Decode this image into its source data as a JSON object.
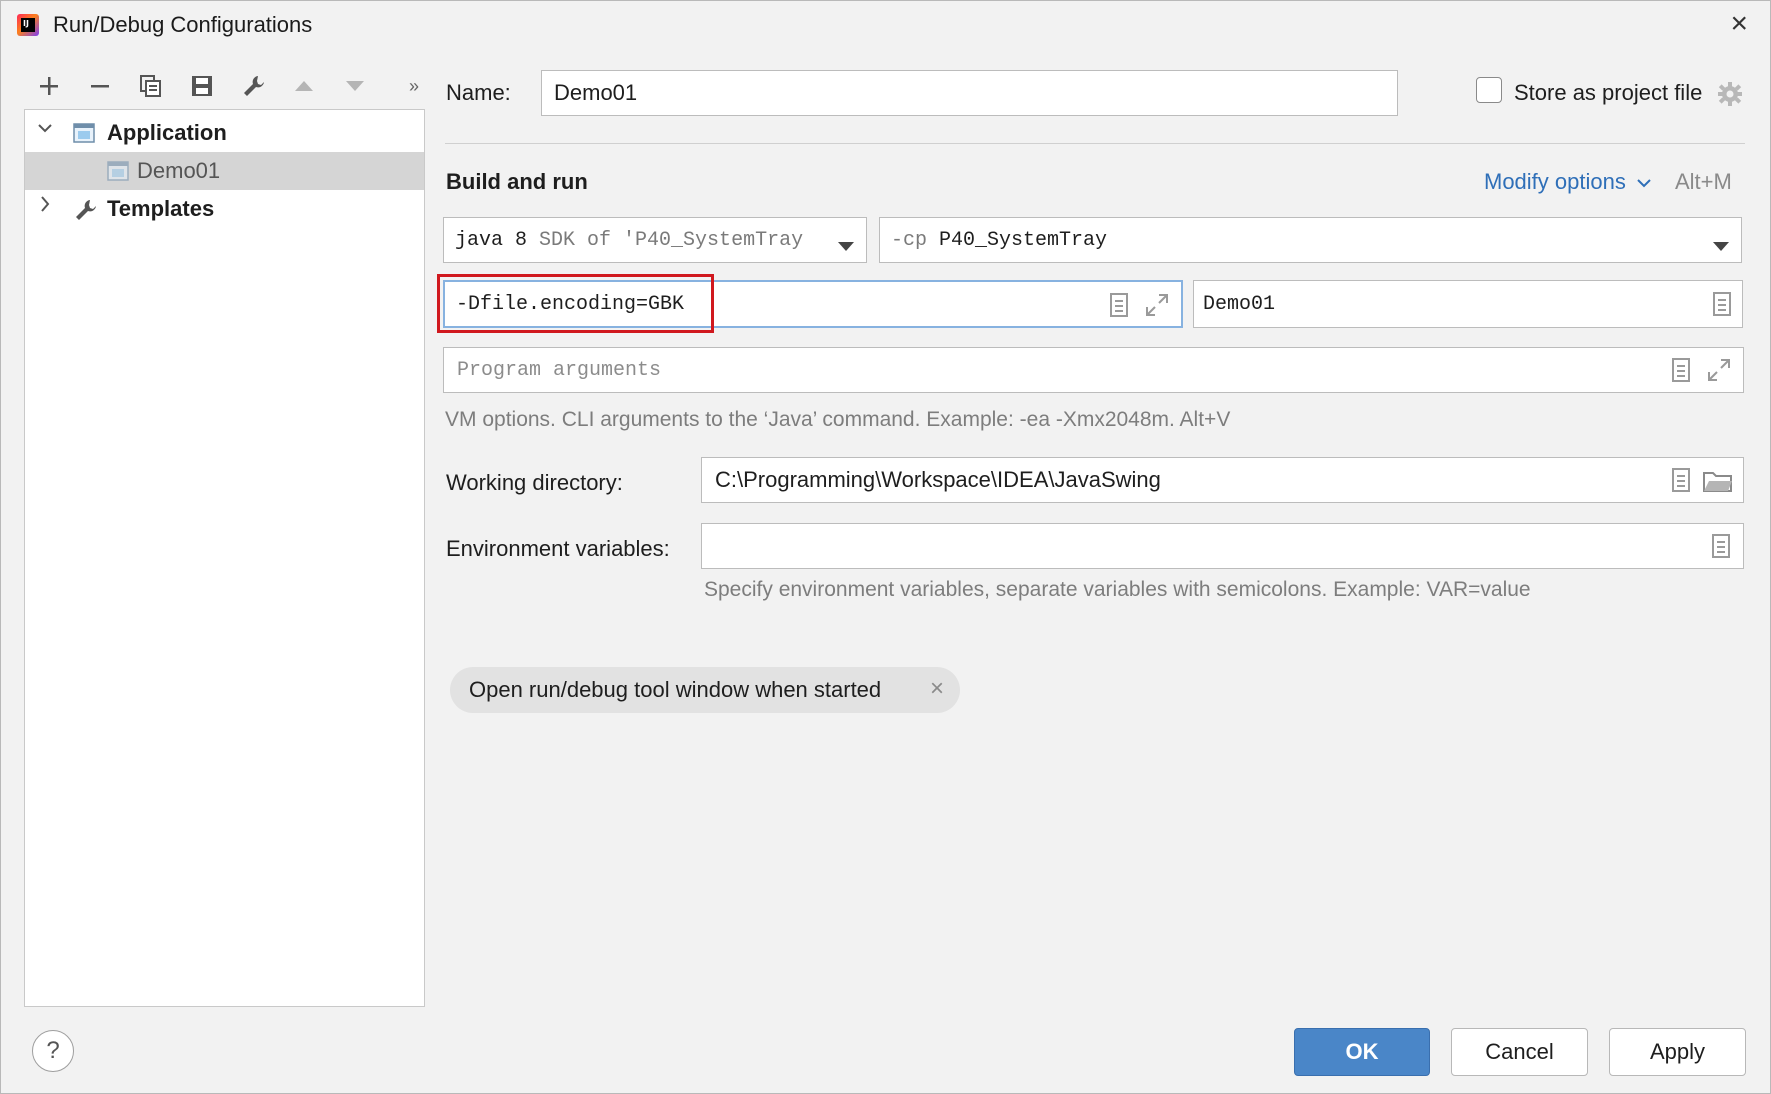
{
  "window": {
    "title": "Run/Debug Configurations"
  },
  "tree": {
    "items": [
      {
        "label": "Application",
        "expanded": true
      },
      {
        "label": "Demo01",
        "selected": true
      },
      {
        "label": "Templates",
        "expanded": false
      }
    ]
  },
  "form": {
    "name_label": "Name:",
    "name_value": "Demo01",
    "store_label": "Store as project file",
    "section_title": "Build and run",
    "modify_options": "Modify options",
    "modify_shortcut": "Alt+M",
    "jdk_main": "java 8",
    "jdk_rest": "SDK of 'P40_SystemTray",
    "cp_prefix": "-cp",
    "cp_value": "P40_SystemTray",
    "vm_options": "-Dfile.encoding=GBK",
    "main_class": "Demo01",
    "program_args_placeholder": "Program arguments",
    "vm_hint": "VM options. CLI arguments to the ‘Java’ command. Example: -ea -Xmx2048m. Alt+V",
    "workdir_label": "Working directory:",
    "workdir_value": "C:\\Programming\\Workspace\\IDEA\\JavaSwing",
    "env_label": "Environment variables:",
    "env_value": "",
    "env_hint": "Specify environment variables, separate variables with semicolons. Example: VAR=value",
    "chip_label": "Open run/debug tool window when started"
  },
  "buttons": {
    "help": "?",
    "ok": "OK",
    "cancel": "Cancel",
    "apply": "Apply"
  },
  "colors": {
    "accent": "#4a86c8",
    "link": "#2f6fb8",
    "highlight_box": "#d0181e",
    "focus_border": "#87b2e0"
  }
}
